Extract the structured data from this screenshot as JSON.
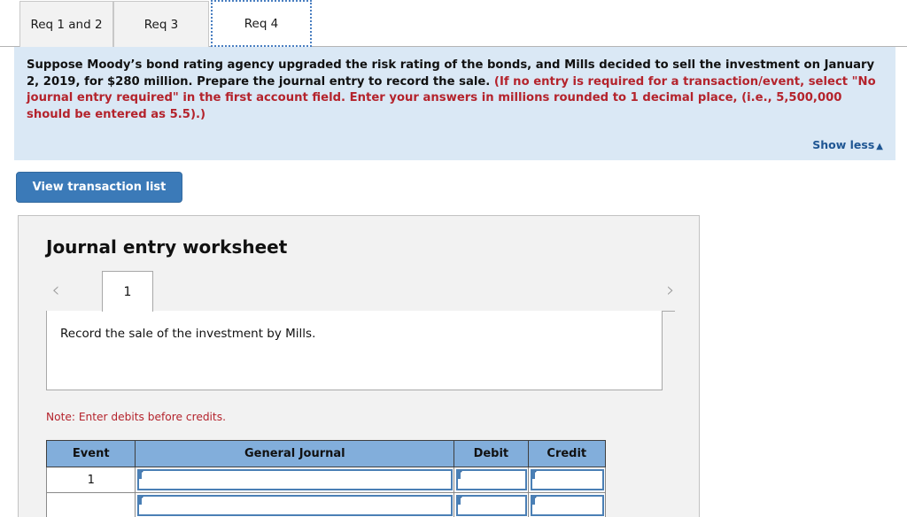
{
  "tabs": [
    {
      "label": "Req 1 and 2",
      "active": false
    },
    {
      "label": "Req 3",
      "active": false
    },
    {
      "label": "Req 4",
      "active": true
    }
  ],
  "instructions": {
    "body_black_1": "Suppose Moody’s bond rating agency upgraded the risk rating of the bonds, and Mills decided to sell the investment on January 2, 2019, for $280 million. Prepare the journal entry to record the sale. ",
    "body_red": "(If no entry is required for a transaction/event, select \"No journal entry required\" in the first account field. Enter your answers in millions rounded to 1 decimal place, (i.e., 5,500,000 should be entered as 5.5).)",
    "show_less_label": "Show less",
    "show_less_caret": "▲"
  },
  "toolbar": {
    "view_transaction_list_label": "View transaction list"
  },
  "worksheet": {
    "title": "Journal entry worksheet",
    "prev_chevron": "‹",
    "next_chevron": "›",
    "pages": [
      "1"
    ],
    "prompt": "Record the sale of the investment by Mills.",
    "note": "Note: Enter debits before credits.",
    "table": {
      "headers": [
        "Event",
        "General Journal",
        "Debit",
        "Credit"
      ],
      "rows": [
        {
          "event": "1",
          "journal": "",
          "debit": "",
          "credit": ""
        },
        {
          "event": "",
          "journal": "",
          "debit": "",
          "credit": ""
        }
      ]
    }
  },
  "colors": {
    "accent_blue": "#3b7ab8",
    "panel_blue": "#dae8f5",
    "table_header_blue": "#82aedb",
    "warning_red": "#b4232c",
    "link_blue": "#1f5693"
  }
}
